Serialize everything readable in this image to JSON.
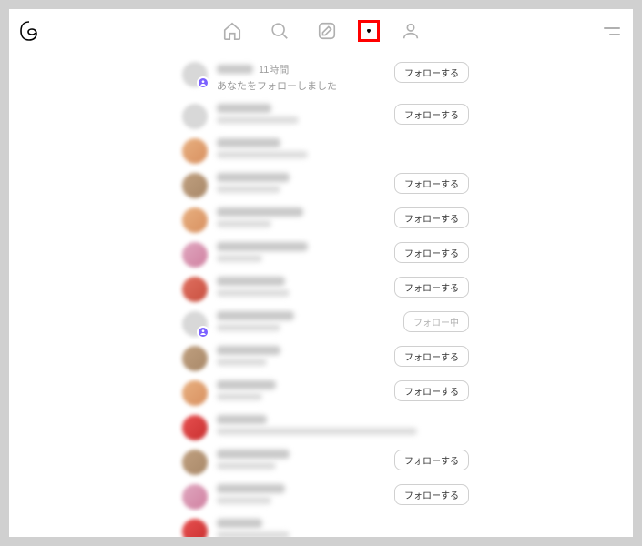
{
  "nav": {
    "active": "activity"
  },
  "rows": [
    {
      "time": "11時間",
      "subtitle": "あなたをフォローしました",
      "button": "フォローする",
      "badge": true,
      "avatar": "tint-grey",
      "nameW": 40,
      "sublineVisible": true
    },
    {
      "button": "フォローする",
      "avatar": "tint-grey",
      "nameW": 60,
      "sub2W": 90
    },
    {
      "button": null,
      "avatar": "tint-orange",
      "nameW": 70,
      "sub2W": 100
    },
    {
      "button": "フォローする",
      "avatar": "tint-brown",
      "nameW": 80,
      "sub2W": 70
    },
    {
      "button": "フォローする",
      "avatar": "tint-orange",
      "nameW": 95,
      "sub2W": 60
    },
    {
      "button": "フォローする",
      "avatar": "tint-pink",
      "nameW": 100,
      "sub2W": 50
    },
    {
      "button": "フォローする",
      "avatar": "tint-red",
      "nameW": 75,
      "sub2W": 80
    },
    {
      "button": "フォロー中",
      "following": true,
      "avatar": "tint-grey",
      "badge": true,
      "nameW": 85,
      "sub2W": 70
    },
    {
      "button": "フォローする",
      "avatar": "tint-brown",
      "nameW": 70,
      "sub2W": 55
    },
    {
      "button": "フォローする",
      "avatar": "tint-orange",
      "nameW": 65,
      "sub2W": 50
    },
    {
      "button": null,
      "avatar": "tint-red2",
      "nameW": 55,
      "sub2W": 220
    },
    {
      "button": "フォローする",
      "avatar": "tint-brown",
      "nameW": 80,
      "sub2W": 65
    },
    {
      "button": "フォローする",
      "avatar": "tint-pink",
      "nameW": 75,
      "sub2W": 60
    },
    {
      "button": null,
      "avatar": "tint-red2",
      "nameW": 50,
      "sub2W": 0
    }
  ]
}
